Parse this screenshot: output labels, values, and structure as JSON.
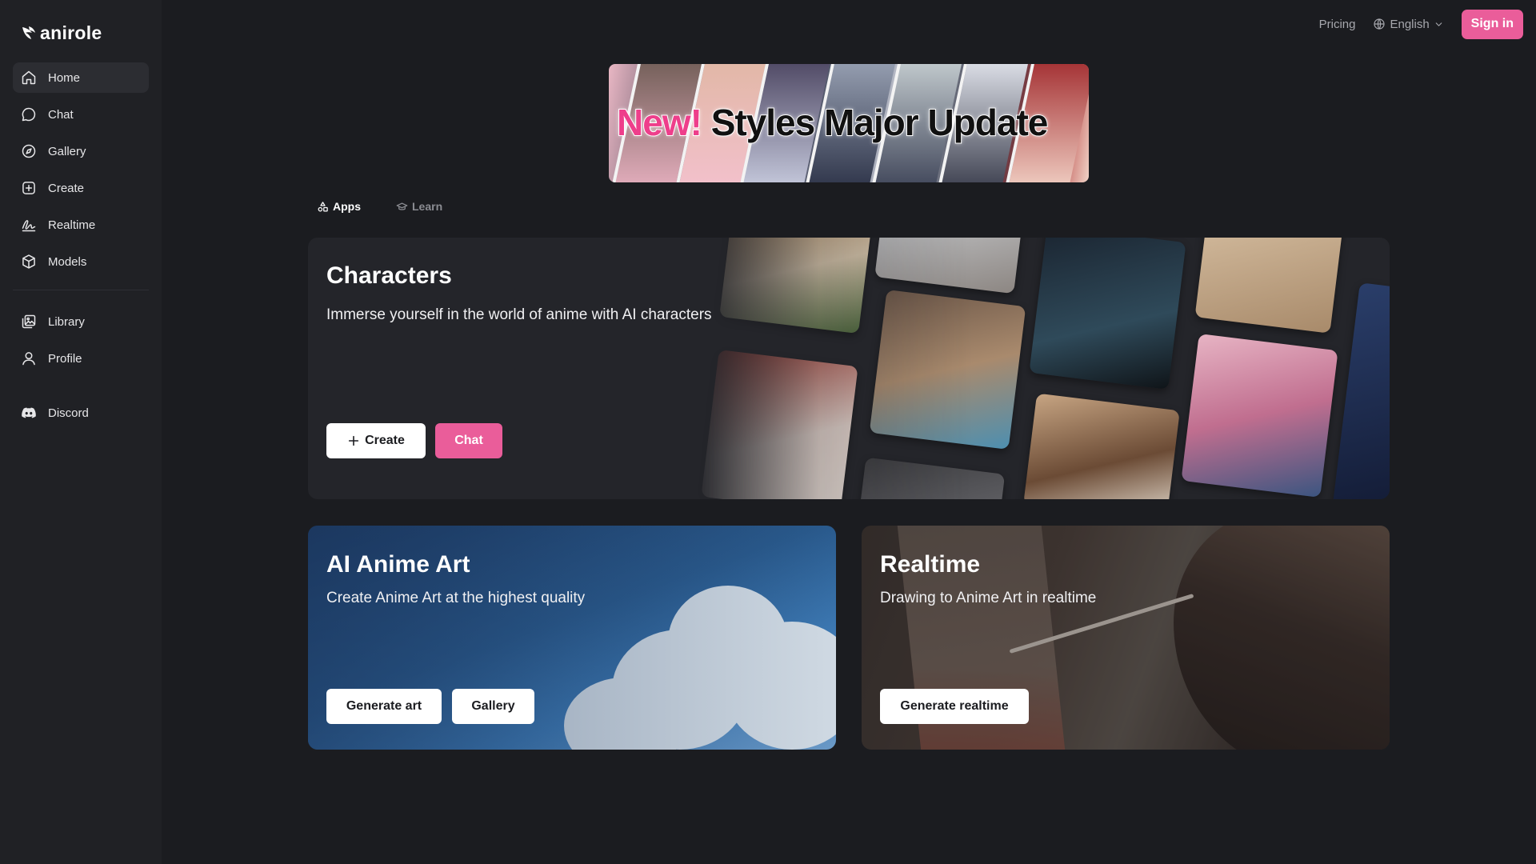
{
  "app": {
    "logo_text": "anirole"
  },
  "sidebar": {
    "items": [
      {
        "label": "Home",
        "icon": "home-icon"
      },
      {
        "label": "Chat",
        "icon": "chat-icon"
      },
      {
        "label": "Gallery",
        "icon": "compass-icon"
      },
      {
        "label": "Create",
        "icon": "plus-square-icon"
      },
      {
        "label": "Realtime",
        "icon": "signature-icon"
      },
      {
        "label": "Models",
        "icon": "cube-icon"
      }
    ],
    "secondary_items": [
      {
        "label": "Library",
        "icon": "image-library-icon"
      },
      {
        "label": "Profile",
        "icon": "user-icon"
      }
    ],
    "discord": {
      "label": "Discord",
      "icon": "discord-icon"
    },
    "active": "Home"
  },
  "header": {
    "pricing_label": "Pricing",
    "language_label": "English",
    "signin_label": "Sign in"
  },
  "banner": {
    "new_text": "New!",
    "main_text": "Styles Major Update"
  },
  "tabs": [
    {
      "label": "Apps",
      "icon": "apps-icon",
      "active": true
    },
    {
      "label": "Learn",
      "icon": "graduation-cap-icon",
      "active": false
    }
  ],
  "cards": {
    "characters": {
      "title": "Characters",
      "subtitle": "Immerse yourself in the world of anime with AI characters",
      "create_label": "Create",
      "chat_label": "Chat"
    },
    "art": {
      "title": "AI Anime Art",
      "subtitle": "Create Anime Art at the highest quality",
      "generate_label": "Generate art",
      "gallery_label": "Gallery"
    },
    "realtime": {
      "title": "Realtime",
      "subtitle": "Drawing to Anime Art in realtime",
      "generate_label": "Generate realtime"
    }
  },
  "colors": {
    "accent": "#ea5d9a",
    "background": "#1b1c20",
    "sidebar": "#202125",
    "card": "#24252a"
  }
}
